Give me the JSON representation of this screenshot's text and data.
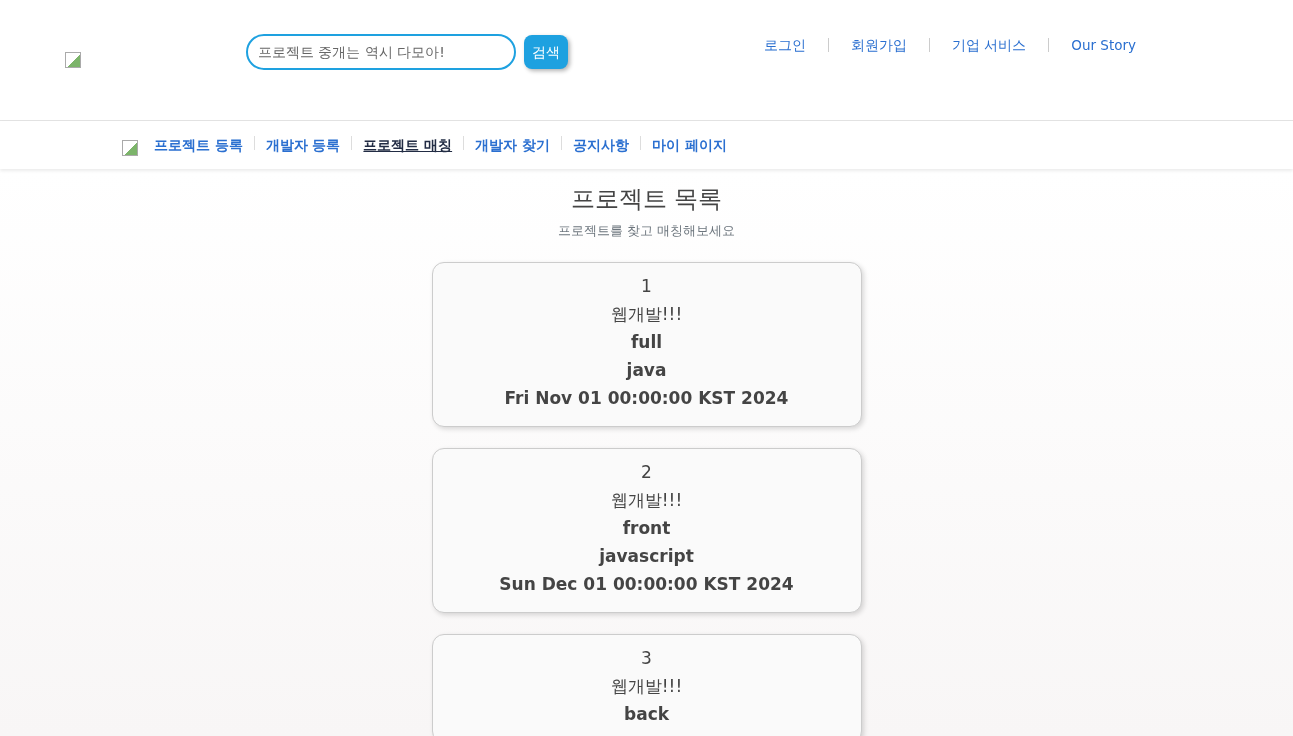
{
  "search": {
    "placeholder": "프로젝트 중개는 역시 다모아!",
    "button": "검색"
  },
  "top_links": [
    "로그인",
    "회원가입",
    "기업 서비스",
    "Our Story"
  ],
  "nav": [
    {
      "label": "프로젝트 등록",
      "selected": false
    },
    {
      "label": "개발자 등록",
      "selected": false
    },
    {
      "label": "프로젝트 매칭",
      "selected": true
    },
    {
      "label": "개발자 찾기",
      "selected": false
    },
    {
      "label": "공지사항",
      "selected": false
    },
    {
      "label": "마이 페이지",
      "selected": false
    }
  ],
  "heading": {
    "title": "프로젝트 목록",
    "subtitle": "프로젝트를 찾고 매칭해보세요"
  },
  "projects": [
    {
      "no": "1",
      "title": "웹개발!!!",
      "position": "full",
      "language": "java",
      "date": "Fri Nov 01 00:00:00 KST 2024"
    },
    {
      "no": "2",
      "title": "웹개발!!!",
      "position": "front",
      "language": "javascript",
      "date": "Sun Dec 01 00:00:00 KST 2024"
    },
    {
      "no": "3",
      "title": "웹개발!!!",
      "position": "back"
    }
  ]
}
